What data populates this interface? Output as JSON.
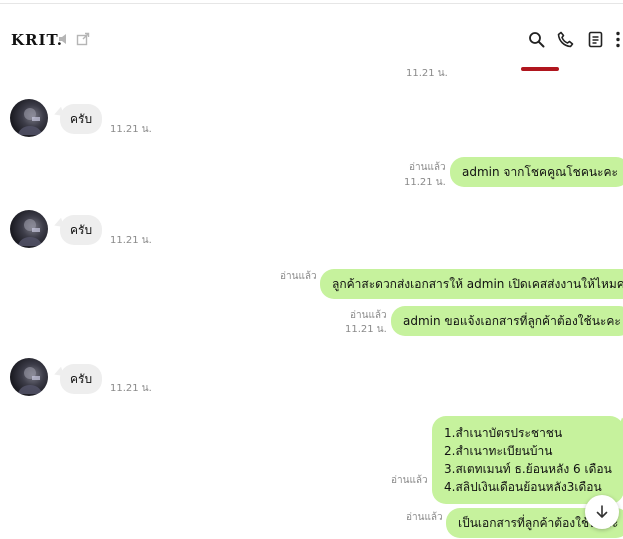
{
  "header": {
    "title": "KRIT.",
    "icons": [
      "mute-icon",
      "external-window-icon",
      "search-icon",
      "phone-icon",
      "notes-icon",
      "more-icon"
    ]
  },
  "messages": {
    "top_time": "11.21 น.",
    "m1": {
      "text": "ครับ",
      "time": "11.21 น."
    },
    "m2": {
      "read": "อ่านแล้ว",
      "time": "11.21 น.",
      "text": "admin จากโชคคูณโชคนะคะ"
    },
    "m3": {
      "text": "ครับ",
      "time": "11.21 น."
    },
    "m4": {
      "read": "อ่านแล้ว",
      "text": "ลูกค้าสะดวกส่งเอกสารให้ admin เปิดเคสส่งงานให้ไหมคะ"
    },
    "m5": {
      "read": "อ่านแล้ว",
      "time": "11.21 น.",
      "text": "admin ขอแจ้งเอกสารที่ลูกค้าต้องใช้นะคะ"
    },
    "m6": {
      "text": "ครับ",
      "time": "11.21 น."
    },
    "m7": {
      "read": "อ่านแล้ว",
      "lines": [
        "1.สำเนาบัตรประชาชน",
        "2.สำเนาทะเบียนบ้าน",
        "3.สเตทเมนท์ ธ.ย้อนหลัง 6 เดือน",
        "4.สลิปเงินเดือนย้อนหลัง3เดือน"
      ]
    },
    "m8": {
      "read": "อ่านแล้ว",
      "text": "เป็นเอกสารที่ลูกค้าต้องใช้นะคะ"
    }
  },
  "colors": {
    "outgoing_bubble": "#c6f29d",
    "incoming_bubble": "#eeeeee",
    "meta_text": "#8a8a8a"
  }
}
